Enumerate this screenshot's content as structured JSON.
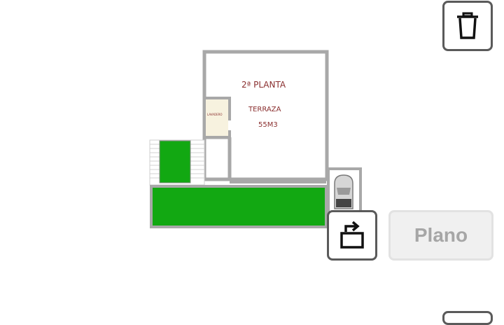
{
  "floorplan": {
    "title": "2ª PLANTA",
    "room_name": "TERRAZA",
    "room_size": "55M3",
    "small_room_label": "LAVADERO"
  },
  "toolbar": {
    "plano_label": "Plano",
    "delete_icon": "trash-icon",
    "rotate_icon": "rotate-icon"
  },
  "colors": {
    "wall": "#a8a8a8",
    "terrace_green": "#12a812",
    "lavadero_fill": "#f7f2df",
    "label_red": "#8a2f2f"
  }
}
